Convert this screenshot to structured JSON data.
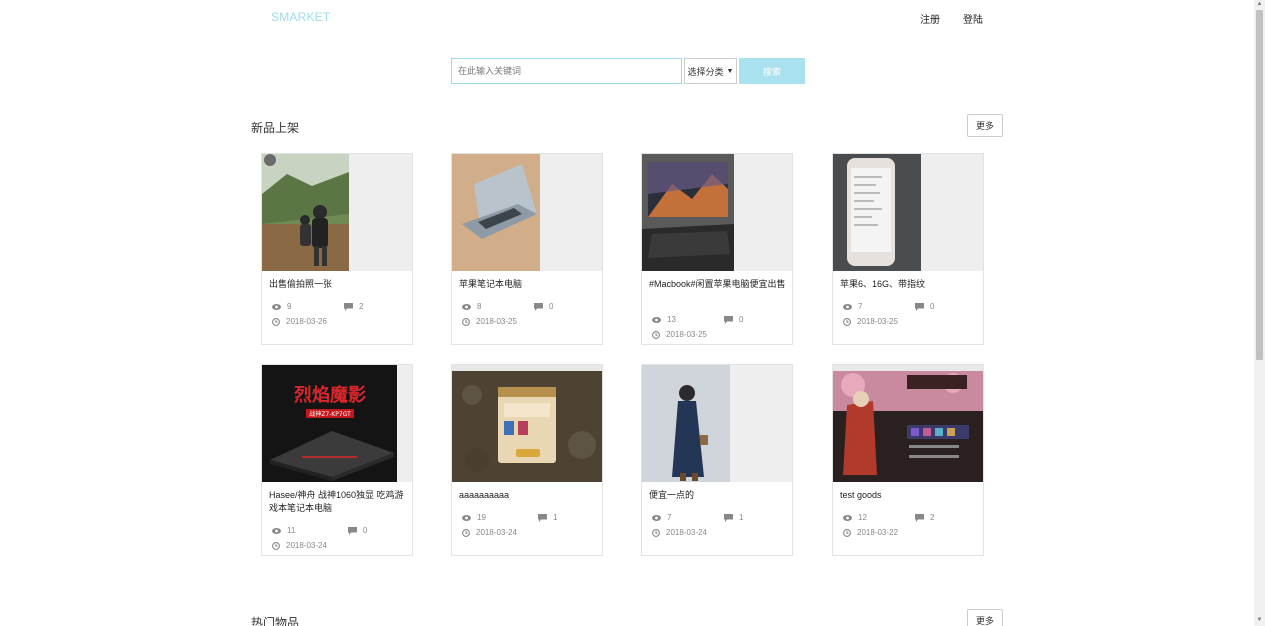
{
  "header": {
    "brand": "SMARKET",
    "register": "注册",
    "login": "登陆"
  },
  "search": {
    "placeholder": "在此输入关键词",
    "category": "选择分类",
    "button": "搜索"
  },
  "sections": {
    "new": {
      "title": "新品上架",
      "more": "更多"
    },
    "hot": {
      "title": "热门物品",
      "more": "更多"
    }
  },
  "products": [
    {
      "title": "出售偷拍照一张",
      "views": "9",
      "comments": "2",
      "date": "2018-03-26"
    },
    {
      "title": "苹果笔记本电脑",
      "views": "8",
      "comments": "0",
      "date": "2018-03-25"
    },
    {
      "title": "#Macbook#闲置苹果电脑便宜出售",
      "views": "13",
      "comments": "0",
      "date": "2018-03-25"
    },
    {
      "title": "苹果6、16G、带指纹",
      "views": "7",
      "comments": "0",
      "date": "2018-03-25"
    },
    {
      "title": "Hasee/神舟 战神1060独显 吃鸡游戏本笔记本电脑",
      "views": "11",
      "comments": "0",
      "date": "2018-03-24"
    },
    {
      "title": "aaaaaaaaaa",
      "views": "19",
      "comments": "1",
      "date": "2018-03-24"
    },
    {
      "title": "便宜一点的",
      "views": "7",
      "comments": "1",
      "date": "2018-03-24"
    },
    {
      "title": "test goods",
      "views": "12",
      "comments": "2",
      "date": "2018-03-22"
    }
  ],
  "laptop_banner": {
    "text": "烈焰魔影",
    "model": "战神Z7-KP7GT"
  },
  "colors": {
    "accent": "#9fdcea",
    "button": "#a9e1ee",
    "meta": "#888888"
  }
}
